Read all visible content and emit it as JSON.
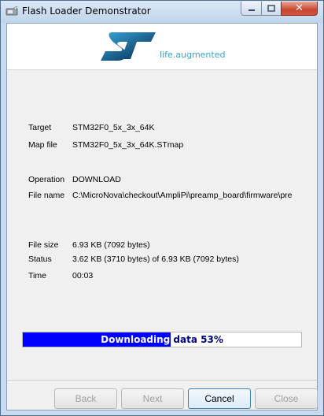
{
  "window": {
    "title": "Flash Loader Demonstrator",
    "icon": "flash-loader-app-icon",
    "controls": {
      "minimize": "minimize-icon",
      "maximize": "maximize-icon",
      "close": "✕"
    }
  },
  "banner": {
    "logo": "st-logo",
    "tagline": "life.augmented"
  },
  "info": {
    "target": {
      "label": "Target",
      "value": "STM32F0_5x_3x_64K"
    },
    "map_file": {
      "label": "Map file",
      "value": "STM32F0_5x_3x_64K.STmap"
    },
    "operation": {
      "label": "Operation",
      "value": "DOWNLOAD"
    },
    "file_name": {
      "label": "File name",
      "value": "C:\\MicroNova\\checkout\\AmpliPi\\preamp_board\\firmware\\pre"
    },
    "file_size": {
      "label": "File size",
      "value": "6.93 KB (7092 bytes)"
    },
    "status": {
      "label": "Status",
      "value": "3.62 KB (3710 bytes) of 6.93 KB (7092 bytes)"
    },
    "time": {
      "label": "Time",
      "value": "00:03"
    }
  },
  "progress": {
    "text": "Downloading data 53%",
    "percent": 53,
    "fill_color": "#0000ff"
  },
  "buttons": {
    "back": "Back",
    "next": "Next",
    "cancel": "Cancel",
    "close": "Close"
  }
}
